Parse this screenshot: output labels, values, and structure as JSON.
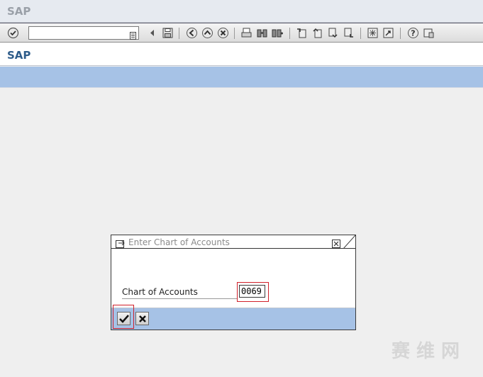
{
  "window": {
    "brand": "SAP"
  },
  "toolbar": {
    "command_field_value": "",
    "icons": [
      "enter-icon",
      "command-history-icon",
      "back-arrow-icon",
      "save-icon",
      "back-icon",
      "exit-icon",
      "cancel-icon",
      "print-icon",
      "find-icon",
      "find-next-icon",
      "first-page-icon",
      "previous-page-icon",
      "next-page-icon",
      "last-page-icon",
      "create-session-icon",
      "shortcut-icon",
      "help-icon",
      "layout-menu-icon"
    ]
  },
  "app": {
    "title": "SAP"
  },
  "dialog": {
    "title": "Enter Chart of Accounts",
    "field_label": "Chart of Accounts",
    "field_value": "0069"
  },
  "watermark": {
    "text": "赛 维 网"
  },
  "colors": {
    "accent": "#a6c2e6",
    "title_blue": "#2e5c8a",
    "highlight": "#d0202a"
  }
}
